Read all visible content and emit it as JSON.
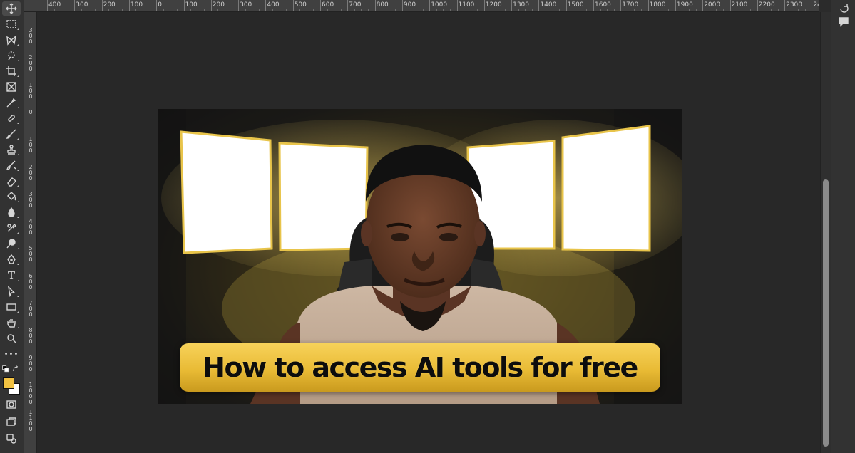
{
  "ruler": {
    "top_labels": [
      "400",
      "300",
      "200",
      "100",
      "0",
      "100",
      "200",
      "300",
      "400",
      "500",
      "600",
      "700",
      "800",
      "900",
      "1000",
      "1100",
      "1200",
      "1300",
      "1400",
      "1500",
      "1600",
      "1700",
      "1800",
      "1900",
      "2000",
      "2100",
      "2200",
      "2300",
      "24"
    ],
    "left_labels": [
      "300",
      "200",
      "100",
      "0",
      "100",
      "200",
      "300",
      "400",
      "500",
      "600",
      "700",
      "800",
      "900",
      "1000",
      "1100"
    ]
  },
  "toolbar": {
    "tools": [
      {
        "id": "move",
        "icon": "move-icon"
      },
      {
        "id": "marquee",
        "icon": "rectangular-marquee-icon"
      },
      {
        "id": "lasso",
        "icon": "lasso-icon"
      },
      {
        "id": "quick-select",
        "icon": "quick-selection-icon"
      },
      {
        "id": "crop",
        "icon": "crop-icon"
      },
      {
        "id": "frame",
        "icon": "frame-icon"
      },
      {
        "id": "eyedropper",
        "icon": "eyedropper-icon"
      },
      {
        "id": "healing",
        "icon": "healing-brush-icon"
      },
      {
        "id": "brush",
        "icon": "brush-icon"
      },
      {
        "id": "stamp",
        "icon": "clone-stamp-icon"
      },
      {
        "id": "history-brush",
        "icon": "history-brush-icon"
      },
      {
        "id": "eraser",
        "icon": "eraser-icon"
      },
      {
        "id": "paint-bucket",
        "icon": "paint-bucket-icon"
      },
      {
        "id": "blur",
        "icon": "blur-icon"
      },
      {
        "id": "dodge",
        "icon": "dodge-icon"
      },
      {
        "id": "burn",
        "icon": "burn-icon"
      },
      {
        "id": "pen",
        "icon": "pen-icon"
      },
      {
        "id": "type",
        "icon": "type-icon",
        "glyph": "T"
      },
      {
        "id": "path-select",
        "icon": "path-selection-icon"
      },
      {
        "id": "rectangle",
        "icon": "rectangle-icon"
      },
      {
        "id": "hand",
        "icon": "hand-icon"
      },
      {
        "id": "zoom",
        "icon": "zoom-icon"
      },
      {
        "id": "more",
        "icon": "more-icon",
        "glyph": "•••"
      }
    ],
    "foreground_color": "#f2c242",
    "background_color": "#ffffff"
  },
  "canvas": {
    "thumbnail_title": "How to access AI tools for free",
    "accent_color": "#f2c242"
  }
}
